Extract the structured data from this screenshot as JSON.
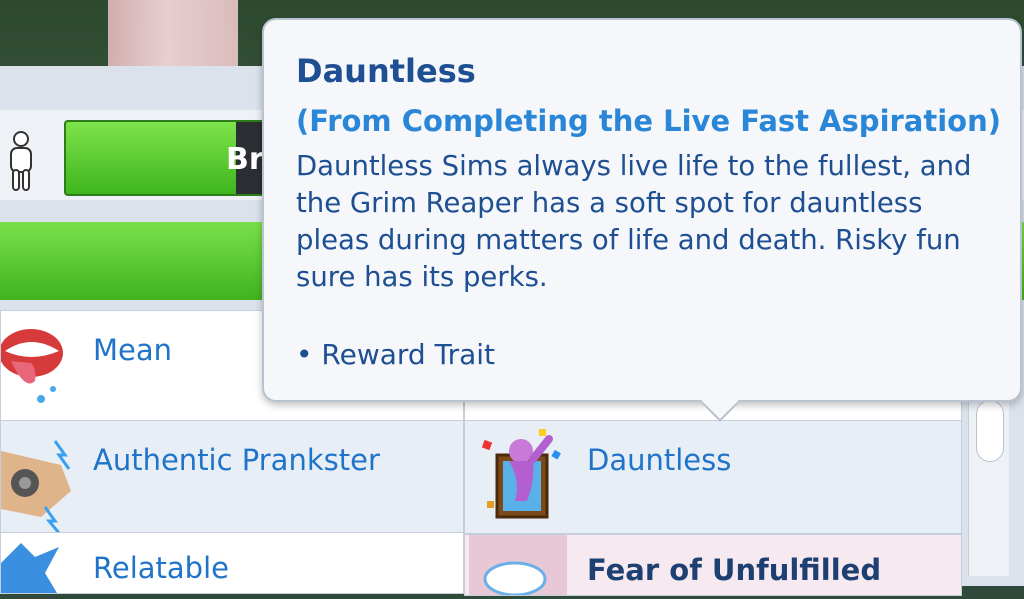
{
  "needs": {
    "bar_label": "Br"
  },
  "traits": [
    {
      "label": "Mean"
    },
    {
      "label": "Authentic Prankster"
    },
    {
      "label": "Relatable"
    },
    {
      "label": "Dauntless"
    },
    {
      "label": "Fear of Unfulfilled"
    }
  ],
  "tooltip": {
    "title": "Dauntless",
    "subtitle": "(From Completing the Live Fast Aspiration)",
    "description": "Dauntless Sims always live life to the fullest, and the Grim Reaper has a soft spot for dauntless pleas during matters of life and death. Risky fun sure has its perks.",
    "bullet": "• Reward Trait"
  },
  "colors": {
    "accent": "#1f74c9",
    "title": "#1d4f92",
    "mood_green": "#3fb31f"
  }
}
